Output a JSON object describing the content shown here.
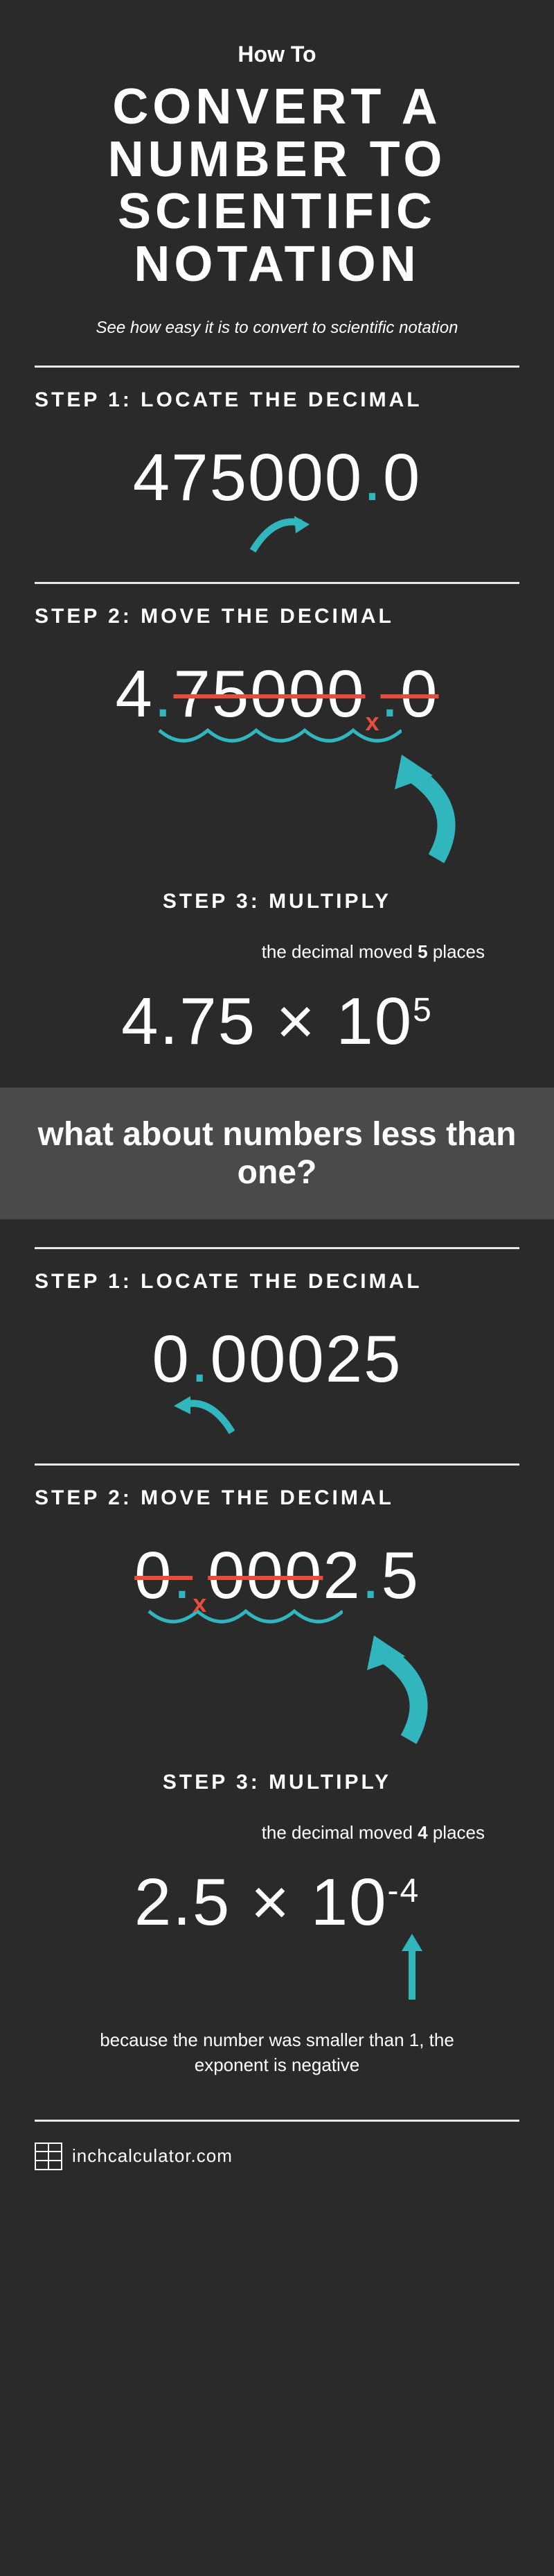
{
  "header": {
    "kicker": "How To",
    "title": "CONVERT A NUMBER TO SCIENTIFIC NOTATION",
    "subtitle": "See how easy it is to convert to scientific notation"
  },
  "sectionA": {
    "step1": {
      "label": "STEP 1: LOCATE THE DECIMAL",
      "pre": "475000",
      "dot": ".",
      "post": "0"
    },
    "step2": {
      "label": "STEP 2: MOVE THE DECIMAL",
      "lead": "4",
      "dot": ".",
      "strike": "75000",
      "x": "x",
      "dot2": ".",
      "trail": "0"
    },
    "step3": {
      "label": "STEP 3: MULTIPLY",
      "note_pre": "the decimal moved ",
      "note_bold": "5",
      "note_post": " places",
      "coeff": "4.75",
      "times": " × 10",
      "exp": "5"
    }
  },
  "interstitial": "what about numbers less than one?",
  "sectionB": {
    "step1": {
      "label": "STEP 1: LOCATE THE DECIMAL",
      "pre": "0",
      "dot": ".",
      "post": "00025"
    },
    "step2": {
      "label": "STEP 2: MOVE THE DECIMAL",
      "strike1": "0",
      "dot1": ".",
      "x": "x",
      "strike2": "000",
      "lead": "2",
      "dot2": ".",
      "trail": "5"
    },
    "step3": {
      "label": "STEP 3: MULTIPLY",
      "note_pre": "the decimal moved ",
      "note_bold": "4",
      "note_post": " places",
      "coeff": "2.5",
      "times": " × 10",
      "exp": "-4"
    },
    "footnote": "because the number was smaller than 1, the exponent is negative"
  },
  "footer": {
    "site": "inchcalculator.com"
  }
}
